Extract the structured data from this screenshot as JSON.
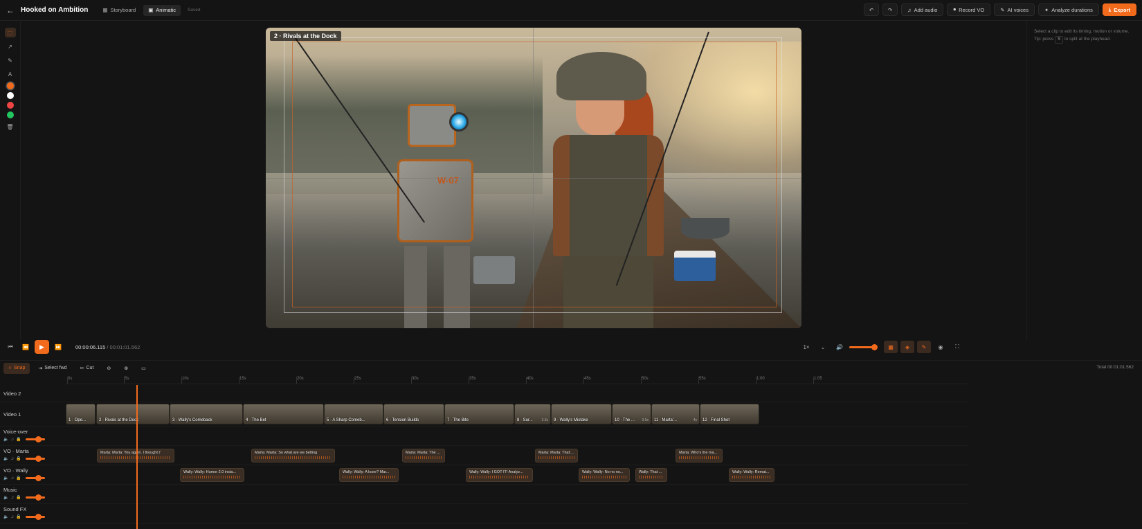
{
  "header": {
    "title": "Hooked on Ambition",
    "tabs": [
      {
        "label": "Storyboard"
      },
      {
        "label": "Animatic"
      }
    ],
    "saved": "Saved",
    "actions": {
      "add_audio": "Add audio",
      "record_vo": "Record VO",
      "ai_voices": "AI voices",
      "analyze": "Analyze durations",
      "export": "Export"
    }
  },
  "tools": {
    "colors": [
      "#f26b1d",
      "#ffffff",
      "#ef4444",
      "#22c55e"
    ]
  },
  "canvas": {
    "scene_label": "2 · Rivals at the Dock",
    "robot_text": "W-07"
  },
  "right_panel": {
    "hint_a": "Select a clip to edit its timing, motion or volume. Tip: press",
    "hint_key": "S",
    "hint_b": "to split at the playhead."
  },
  "playback": {
    "current": "00:00:06.115",
    "total": "00:01:01.562",
    "separator": "/",
    "speed": "1×"
  },
  "timeline_toolbar": {
    "snap": "Snap",
    "select_fwd": "Select fwd",
    "cut": "Cut",
    "total": "Total 00:01:01.562"
  },
  "ruler": [
    "0s",
    "5s",
    "10s",
    "15s",
    "20s",
    "25s",
    "30s",
    "35s",
    "40s",
    "45s",
    "50s",
    "55s",
    "1:00",
    "1:05"
  ],
  "tracks": {
    "video2": "Video 2",
    "video1": "Video 1",
    "voiceover": "Voice-over",
    "vo_marta": "VO · Marta",
    "vo_wally": "VO · Wally",
    "music": "Music",
    "sfx": "Sound FX"
  },
  "video_clips": [
    {
      "label": "1 · Ope..."
    },
    {
      "label": "2 · Rivals at the Dock"
    },
    {
      "label": "3 · Wally's Comeback"
    },
    {
      "label": "4 · The Bet"
    },
    {
      "label": "5 · A Sharp Comeb..."
    },
    {
      "label": "6 · Tension Builds"
    },
    {
      "label": "7 · The Bite"
    },
    {
      "label": "8 · Sur...",
      "dur": "3.3s"
    },
    {
      "label": "9 · Wally's Mistake"
    },
    {
      "label": "10 · The ...",
      "dur": "3.5s"
    },
    {
      "label": "11 · Marta'...",
      "dur": "4s"
    },
    {
      "label": "12 · Final Shot"
    }
  ],
  "marta_clips": [
    "Marta: Marta: You again. I thought I'",
    "Marta: Marta: So what are we betting",
    "Marta: Marta: The ...",
    "Marta: Marta: That'...",
    "Marta: Who's the ma..."
  ],
  "wally_clips": [
    "Wally: Wally: Humor 2.0 insta...",
    "Wally: Wally: A loser? Mar...",
    "Wally: Wally: I GOT IT! Analyz...",
    "Wally: Wally: No no no...",
    "Wally: That ...",
    "Wally: Wally: Remat..."
  ]
}
